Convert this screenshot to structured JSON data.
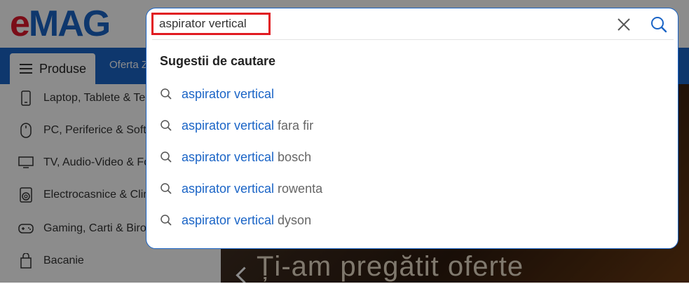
{
  "header": {
    "logo_e": "e",
    "logo_rest": "MAG",
    "produse_label": "Produse",
    "oferta_label": "Oferta Z"
  },
  "sidebar": {
    "items": [
      {
        "label": "Laptop, Tablete & Telefoane",
        "icon": "phone-icon"
      },
      {
        "label": "PC, Periferice & Software",
        "icon": "mouse-icon"
      },
      {
        "label": "TV, Audio-Video & Foto",
        "icon": "tv-icon"
      },
      {
        "label": "Electrocasnice & Climatizare",
        "icon": "washing-machine-icon"
      },
      {
        "label": "Gaming, Carti & Birotica",
        "icon": "gamepad-icon"
      },
      {
        "label": "Bacanie",
        "icon": "bag-icon"
      }
    ]
  },
  "hero": {
    "text": "Ți-am pregătit oferte"
  },
  "search": {
    "value": "aspirator vertical",
    "suggestions_title": "Sugestii de cautare",
    "suggestions": [
      {
        "query": "aspirator vertical",
        "rest": ""
      },
      {
        "query": "aspirator vertical",
        "rest": " fara fir"
      },
      {
        "query": "aspirator vertical",
        "rest": " bosch"
      },
      {
        "query": "aspirator vertical",
        "rest": " rowenta"
      },
      {
        "query": "aspirator vertical",
        "rest": " dyson"
      }
    ]
  },
  "colors": {
    "brand_blue": "#1a64c6",
    "brand_red": "#e0182d",
    "highlight_border": "#e11b22"
  }
}
